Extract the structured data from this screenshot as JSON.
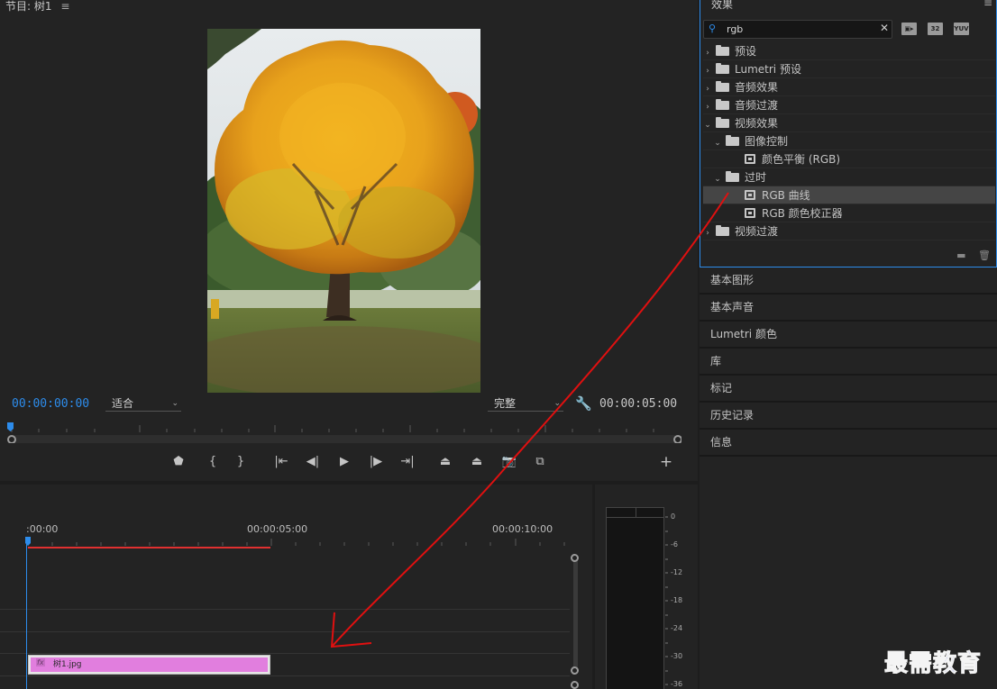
{
  "program_monitor": {
    "title": "节目: 树1",
    "menu_icon": "≡",
    "timecode_current": "00:00:00:00",
    "timecode_duration": "00:00:05:00",
    "fit_dropdown": "适合",
    "quality_dropdown": "完整",
    "transport_buttons": [
      "add-marker",
      "mark-in",
      "mark-out",
      "go-to-in",
      "step-back",
      "play",
      "step-forward",
      "go-to-out",
      "lift",
      "extract",
      "export-frame",
      "comparison-view",
      "add-button"
    ],
    "accent_color": "#2d8ceb"
  },
  "timeline": {
    "ruler_times": [
      ":00:00",
      "00:00:05:00",
      "00:00:10:00"
    ],
    "clip_name": "树1.jpg",
    "clip_fx_badge": "fx",
    "clip_color": "#e17ede",
    "work_area_color": "#e03030"
  },
  "audio_meter": {
    "db_labels": [
      "0",
      "-6",
      "-12",
      "-18",
      "-24",
      "-30",
      "-36"
    ]
  },
  "effects_panel": {
    "title": "效果",
    "menu_icon": "≡",
    "search_value": "rgb",
    "filter_buttons": [
      "accelerated-effects-filter",
      "32-bit-filter",
      "yuv-filter"
    ],
    "filter_labels": [
      "32",
      "YUV"
    ],
    "tree": [
      {
        "label": "预设",
        "expanded": false,
        "level": 0
      },
      {
        "label": "Lumetri 预设",
        "expanded": false,
        "level": 0
      },
      {
        "label": "音频效果",
        "expanded": false,
        "level": 0
      },
      {
        "label": "音频过渡",
        "expanded": false,
        "level": 0
      },
      {
        "label": "视频效果",
        "expanded": true,
        "level": 0
      },
      {
        "label": "图像控制",
        "expanded": true,
        "level": 1
      },
      {
        "label": "颜色平衡 (RGB)",
        "level": 2
      },
      {
        "label": "过时",
        "expanded": true,
        "level": 1
      },
      {
        "label": "RGB 曲线",
        "level": 2,
        "selected": true
      },
      {
        "label": "RGB 颜色校正器",
        "level": 2
      },
      {
        "label": "视频过渡",
        "expanded": false,
        "level": 0
      }
    ]
  },
  "panels": [
    "基本图形",
    "基本声音",
    "Lumetri 颜色",
    "库",
    "标记",
    "历史记录",
    "信息"
  ],
  "watermark": "最需教育",
  "annotation_arrow_color": "#e01010"
}
